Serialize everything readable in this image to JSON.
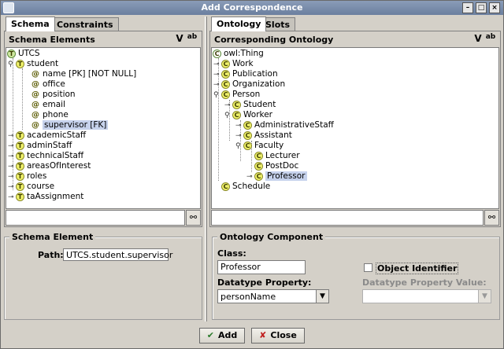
{
  "window": {
    "title": "Add Correspondence",
    "controls": {
      "minimize": "–",
      "maximize": "□",
      "close": "×"
    }
  },
  "left": {
    "tabs": [
      {
        "label": "Schema",
        "active": true
      },
      {
        "label": "Constraints",
        "active": false
      }
    ],
    "tree_title": "Schema Elements",
    "header_icons": [
      "v-icon",
      "ab-sort-icon"
    ],
    "tree": [
      {
        "label": "UTCS",
        "badge": "T",
        "root": true
      },
      {
        "label": "student",
        "badge": "T",
        "handle": "expanded"
      },
      {
        "label": "name [PK] [NOT NULL]",
        "kind": "attribute"
      },
      {
        "label": "office",
        "kind": "attribute"
      },
      {
        "label": "position",
        "kind": "attribute"
      },
      {
        "label": "email",
        "kind": "attribute"
      },
      {
        "label": "phone",
        "kind": "attribute"
      },
      {
        "label": "supervisor [FK]",
        "kind": "attribute",
        "selected": true
      },
      {
        "label": "academicStaff",
        "badge": "T",
        "handle": "collapsed"
      },
      {
        "label": "adminStaff",
        "badge": "T",
        "handle": "collapsed"
      },
      {
        "label": "technicalStaff",
        "badge": "T",
        "handle": "collapsed"
      },
      {
        "label": "areasOfInterest",
        "badge": "T",
        "handle": "collapsed"
      },
      {
        "label": "roles",
        "badge": "T",
        "handle": "collapsed"
      },
      {
        "label": "course",
        "badge": "T",
        "handle": "collapsed"
      },
      {
        "label": "taAssignment",
        "badge": "T",
        "handle": "collapsed"
      }
    ],
    "search_value": "",
    "group_title": "Schema Element",
    "path_label": "Path:",
    "path_value": "UTCS.student.supervisor"
  },
  "right": {
    "tabs": [
      {
        "label": "Ontology",
        "active": true
      },
      {
        "label": "Slots",
        "active": false
      }
    ],
    "tree_title": "Corresponding Ontology",
    "tree": [
      {
        "label": "owl:Thing",
        "badge": "C",
        "root": true
      },
      {
        "label": "Work",
        "badge": "C",
        "handle": "collapsed"
      },
      {
        "label": "Publication",
        "badge": "C",
        "handle": "collapsed"
      },
      {
        "label": "Organization",
        "badge": "C",
        "handle": "collapsed"
      },
      {
        "label": "Person",
        "badge": "C",
        "handle": "expanded"
      },
      {
        "label": "Student",
        "badge": "C",
        "handle": "collapsed"
      },
      {
        "label": "Worker",
        "badge": "C",
        "handle": "expanded"
      },
      {
        "label": "AdministrativeStaff",
        "badge": "C",
        "handle": "collapsed"
      },
      {
        "label": "Assistant",
        "badge": "C",
        "handle": "collapsed"
      },
      {
        "label": "Faculty",
        "badge": "C",
        "handle": "expanded"
      },
      {
        "label": "Lecturer",
        "badge": "C"
      },
      {
        "label": "PostDoc",
        "badge": "C"
      },
      {
        "label": "Professor",
        "badge": "C",
        "handle": "collapsed",
        "selected": true
      },
      {
        "label": "Schedule",
        "badge": "C"
      }
    ],
    "search_value": "",
    "group_title": "Ontology Component",
    "class_label": "Class:",
    "class_value": "Professor",
    "object_identifier_label": "Object Identifier",
    "object_identifier_checked": false,
    "datatype_property_label": "Datatype Property:",
    "datatype_property_value": "personName",
    "datatype_value_label": "Datatype Property Value:",
    "datatype_value_value": ""
  },
  "buttons": {
    "add": {
      "label": "Add",
      "icon": "✔"
    },
    "close": {
      "label": "Close",
      "icon": "✘"
    }
  }
}
